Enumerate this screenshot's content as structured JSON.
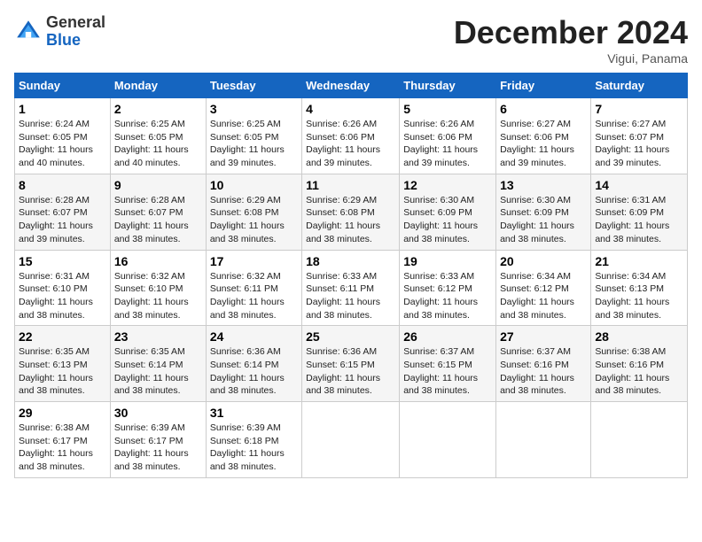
{
  "header": {
    "logo_general": "General",
    "logo_blue": "Blue",
    "month_title": "December 2024",
    "location": "Vigui, Panama"
  },
  "days_of_week": [
    "Sunday",
    "Monday",
    "Tuesday",
    "Wednesday",
    "Thursday",
    "Friday",
    "Saturday"
  ],
  "weeks": [
    [
      {
        "day": "1",
        "sunrise": "6:24 AM",
        "sunset": "6:05 PM",
        "daylight": "Daylight: 11 hours and 40 minutes."
      },
      {
        "day": "2",
        "sunrise": "6:25 AM",
        "sunset": "6:05 PM",
        "daylight": "Daylight: 11 hours and 40 minutes."
      },
      {
        "day": "3",
        "sunrise": "6:25 AM",
        "sunset": "6:05 PM",
        "daylight": "Daylight: 11 hours and 39 minutes."
      },
      {
        "day": "4",
        "sunrise": "6:26 AM",
        "sunset": "6:06 PM",
        "daylight": "Daylight: 11 hours and 39 minutes."
      },
      {
        "day": "5",
        "sunrise": "6:26 AM",
        "sunset": "6:06 PM",
        "daylight": "Daylight: 11 hours and 39 minutes."
      },
      {
        "day": "6",
        "sunrise": "6:27 AM",
        "sunset": "6:06 PM",
        "daylight": "Daylight: 11 hours and 39 minutes."
      },
      {
        "day": "7",
        "sunrise": "6:27 AM",
        "sunset": "6:07 PM",
        "daylight": "Daylight: 11 hours and 39 minutes."
      }
    ],
    [
      {
        "day": "8",
        "sunrise": "6:28 AM",
        "sunset": "6:07 PM",
        "daylight": "Daylight: 11 hours and 39 minutes."
      },
      {
        "day": "9",
        "sunrise": "6:28 AM",
        "sunset": "6:07 PM",
        "daylight": "Daylight: 11 hours and 38 minutes."
      },
      {
        "day": "10",
        "sunrise": "6:29 AM",
        "sunset": "6:08 PM",
        "daylight": "Daylight: 11 hours and 38 minutes."
      },
      {
        "day": "11",
        "sunrise": "6:29 AM",
        "sunset": "6:08 PM",
        "daylight": "Daylight: 11 hours and 38 minutes."
      },
      {
        "day": "12",
        "sunrise": "6:30 AM",
        "sunset": "6:09 PM",
        "daylight": "Daylight: 11 hours and 38 minutes."
      },
      {
        "day": "13",
        "sunrise": "6:30 AM",
        "sunset": "6:09 PM",
        "daylight": "Daylight: 11 hours and 38 minutes."
      },
      {
        "day": "14",
        "sunrise": "6:31 AM",
        "sunset": "6:09 PM",
        "daylight": "Daylight: 11 hours and 38 minutes."
      }
    ],
    [
      {
        "day": "15",
        "sunrise": "6:31 AM",
        "sunset": "6:10 PM",
        "daylight": "Daylight: 11 hours and 38 minutes."
      },
      {
        "day": "16",
        "sunrise": "6:32 AM",
        "sunset": "6:10 PM",
        "daylight": "Daylight: 11 hours and 38 minutes."
      },
      {
        "day": "17",
        "sunrise": "6:32 AM",
        "sunset": "6:11 PM",
        "daylight": "Daylight: 11 hours and 38 minutes."
      },
      {
        "day": "18",
        "sunrise": "6:33 AM",
        "sunset": "6:11 PM",
        "daylight": "Daylight: 11 hours and 38 minutes."
      },
      {
        "day": "19",
        "sunrise": "6:33 AM",
        "sunset": "6:12 PM",
        "daylight": "Daylight: 11 hours and 38 minutes."
      },
      {
        "day": "20",
        "sunrise": "6:34 AM",
        "sunset": "6:12 PM",
        "daylight": "Daylight: 11 hours and 38 minutes."
      },
      {
        "day": "21",
        "sunrise": "6:34 AM",
        "sunset": "6:13 PM",
        "daylight": "Daylight: 11 hours and 38 minutes."
      }
    ],
    [
      {
        "day": "22",
        "sunrise": "6:35 AM",
        "sunset": "6:13 PM",
        "daylight": "Daylight: 11 hours and 38 minutes."
      },
      {
        "day": "23",
        "sunrise": "6:35 AM",
        "sunset": "6:14 PM",
        "daylight": "Daylight: 11 hours and 38 minutes."
      },
      {
        "day": "24",
        "sunrise": "6:36 AM",
        "sunset": "6:14 PM",
        "daylight": "Daylight: 11 hours and 38 minutes."
      },
      {
        "day": "25",
        "sunrise": "6:36 AM",
        "sunset": "6:15 PM",
        "daylight": "Daylight: 11 hours and 38 minutes."
      },
      {
        "day": "26",
        "sunrise": "6:37 AM",
        "sunset": "6:15 PM",
        "daylight": "Daylight: 11 hours and 38 minutes."
      },
      {
        "day": "27",
        "sunrise": "6:37 AM",
        "sunset": "6:16 PM",
        "daylight": "Daylight: 11 hours and 38 minutes."
      },
      {
        "day": "28",
        "sunrise": "6:38 AM",
        "sunset": "6:16 PM",
        "daylight": "Daylight: 11 hours and 38 minutes."
      }
    ],
    [
      {
        "day": "29",
        "sunrise": "6:38 AM",
        "sunset": "6:17 PM",
        "daylight": "Daylight: 11 hours and 38 minutes."
      },
      {
        "day": "30",
        "sunrise": "6:39 AM",
        "sunset": "6:17 PM",
        "daylight": "Daylight: 11 hours and 38 minutes."
      },
      {
        "day": "31",
        "sunrise": "6:39 AM",
        "sunset": "6:18 PM",
        "daylight": "Daylight: 11 hours and 38 minutes."
      },
      null,
      null,
      null,
      null
    ]
  ],
  "row_classes": [
    "cell-row-odd",
    "cell-row-even",
    "cell-row-odd",
    "cell-row-even",
    "cell-row-odd"
  ]
}
